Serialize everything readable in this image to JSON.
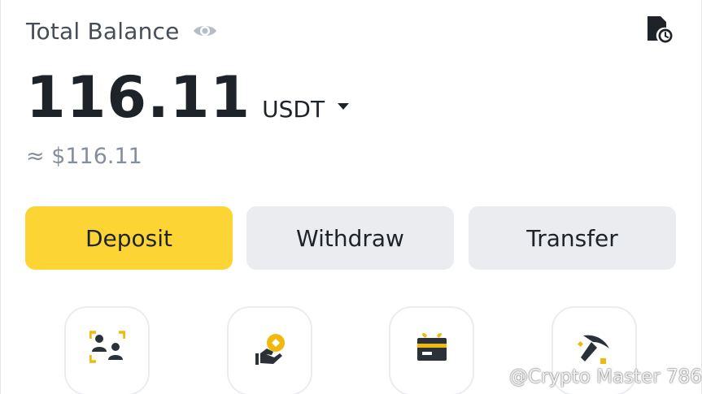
{
  "balance": {
    "label": "Total Balance",
    "amount": "116.11",
    "currency": "USDT",
    "fiat_equivalent": "≈ $116.11"
  },
  "actions": {
    "deposit": "Deposit",
    "withdraw": "Withdraw",
    "transfer": "Transfer"
  },
  "shortcuts": [
    {
      "icon": "p2p-users-icon"
    },
    {
      "icon": "earn-coin-icon"
    },
    {
      "icon": "gift-card-icon"
    },
    {
      "icon": "mining-pickaxe-icon"
    }
  ],
  "watermark": "@Crypto Master 786",
  "colors": {
    "accent": "#fcd535",
    "button_secondary": "#eaecef",
    "text_primary": "#1e2329",
    "text_secondary": "#848e9c",
    "icon_dark": "#2b3139"
  }
}
